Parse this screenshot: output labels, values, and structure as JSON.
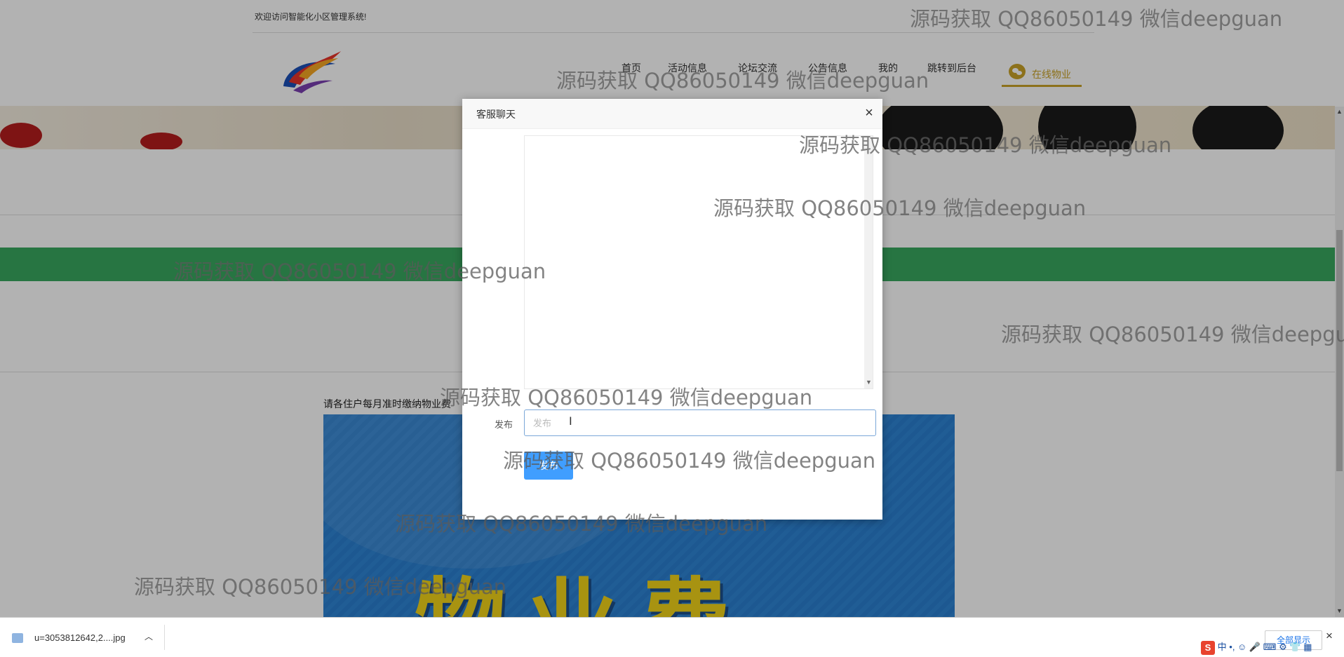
{
  "topbar": {
    "welcome": "欢迎访问智能化小区管理系统!"
  },
  "nav": {
    "items": [
      {
        "label": "首页"
      },
      {
        "label": "活动信息"
      },
      {
        "label": "论坛交流"
      },
      {
        "label": "公告信息"
      },
      {
        "label": "我的"
      },
      {
        "label": "跳转到后台"
      }
    ],
    "active": {
      "label": "在线物业",
      "icon": "wechat-icon",
      "color": "#c9a227"
    }
  },
  "main": {
    "notice": "请各住户每月准时缴纳物业费",
    "poster_text": "物业费"
  },
  "modal": {
    "title": "客服聊天",
    "close": "×",
    "field_label": "发布",
    "input_placeholder": "发布",
    "input_value": "",
    "send_label": "发布"
  },
  "watermark": "源码获取 QQ86050149 微信deepguan",
  "download_bar": {
    "file_name": "u=3053812642,2....jpg",
    "show_all": "全部显示",
    "close": "×"
  },
  "taskbar": {
    "ime_label": "中"
  },
  "colors": {
    "accent": "#409eff",
    "green": "#39a85f",
    "gold": "#c9a227"
  }
}
